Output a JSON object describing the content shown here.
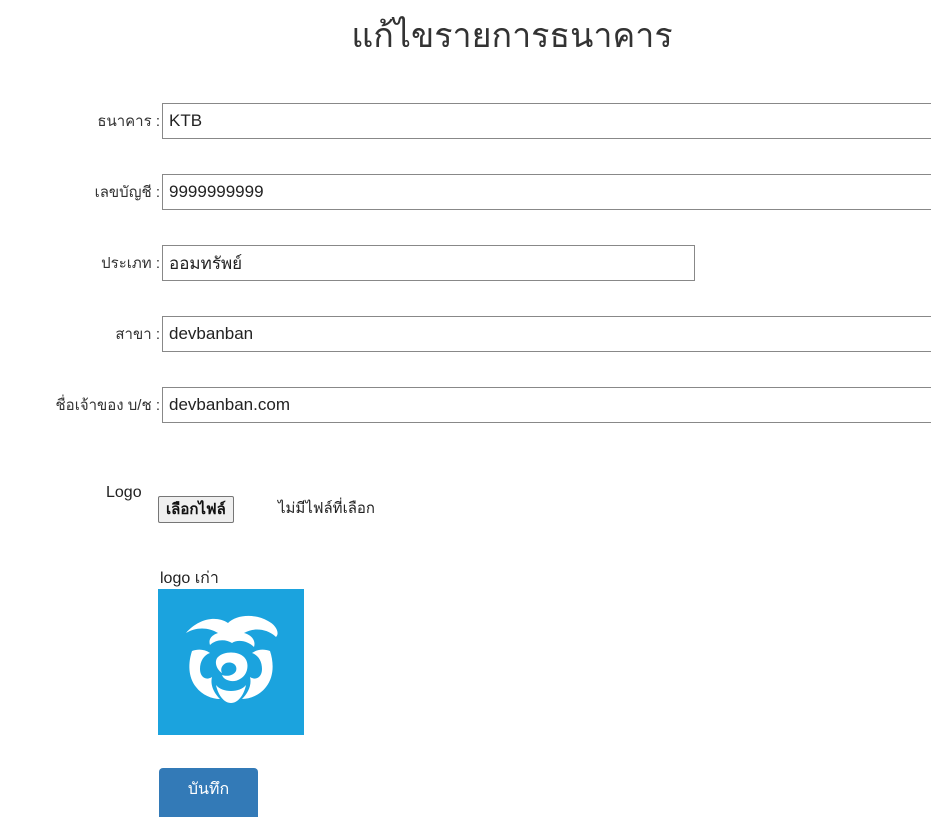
{
  "page": {
    "title": "แก้ไขรายการธนาคาร"
  },
  "form": {
    "bank": {
      "label": "ธนาคาร :",
      "value": "KTB"
    },
    "account_no": {
      "label": "เลขบัญชี :",
      "value": "9999999999"
    },
    "type": {
      "label": "ประเภท :",
      "value": "ออมทรัพย์"
    },
    "branch": {
      "label": "สาขา :",
      "value": "devbanban"
    },
    "owner": {
      "label": "ชื่อเจ้าของ บ/ช :",
      "value": "devbanban.com"
    },
    "logo": {
      "label": "Logo",
      "choose_button": "เลือกไฟล์",
      "status": "ไม่มีไฟล์ที่เลือก"
    },
    "old_logo": {
      "label": "logo เก่า",
      "icon": "krungthai-bank-logo-icon",
      "background_color": "#1ba3de"
    },
    "save_button": "บันทึก",
    "save_button_color": "#337ab7"
  }
}
